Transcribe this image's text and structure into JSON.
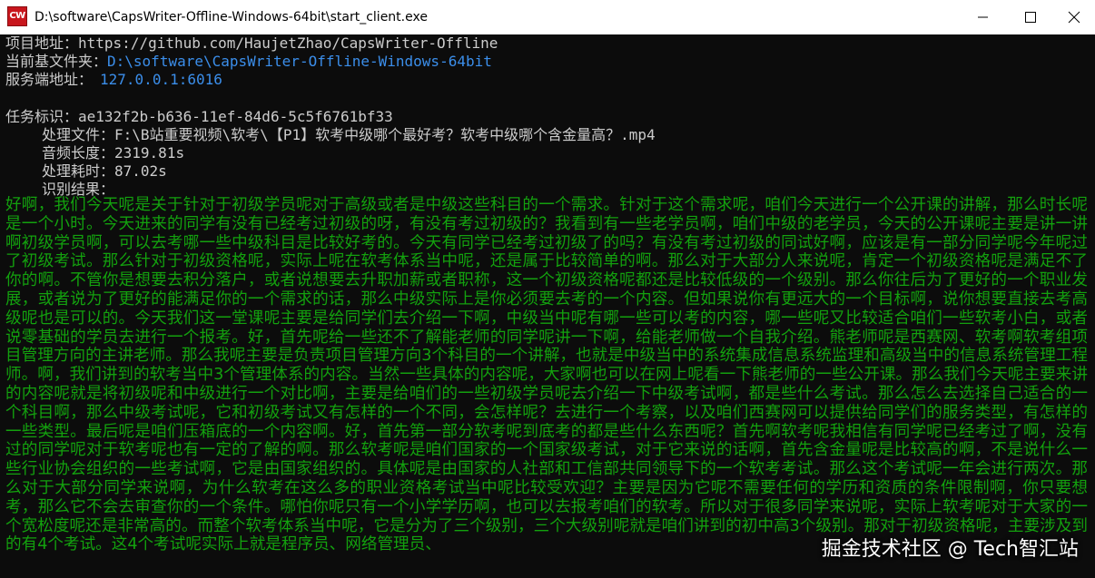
{
  "window": {
    "title": "D:\\software\\CapsWriter-Offline-Windows-64bit\\start_client.exe",
    "icon_label": "CW"
  },
  "header": {
    "project_label": "项目地址：",
    "project_value": "https://github.com/HaujetZhao/CapsWriter-Offline",
    "basedir_label": "当前基文件夹：",
    "basedir_value": "D:\\software\\CapsWriter-Offline-Windows-64bit",
    "server_label": "服务端地址：",
    "server_value": "127.0.0.1:6016"
  },
  "task": {
    "id_label": "任务标识：",
    "id_value": "ae132f2b-b636-11ef-84d6-5c5f6761bf33",
    "file_label": "处理文件：",
    "file_value": "F:\\B站重要视频\\软考\\【P1】软考中级哪个最好考？软考中级哪个含金量高？.mp4",
    "duration_label": "音频长度：",
    "duration_value": "2319.81s",
    "elapsed_label": "处理耗时：",
    "elapsed_value": "87.02s",
    "result_label": "识别结果："
  },
  "result_text": "好啊，我们今天呢是关于针对于初级学员呢对于高级或者是中级这些科目的一个需求。针对于这个需求呢，咱们今天进行一个公开课的讲解，那么时长呢是一个小时。今天进来的同学有没有已经考过初级的呀，有没有考过初级的？我看到有一些老学员啊，咱们中级的老学员，今天的公开课呢主要是讲一讲啊初级学员啊，可以去考哪一些中级科目是比较好考的。今天有同学已经考过初级了的吗？有没有考过初级的同试好啊，应该是有一部分同学呢今年呢过了初级考试。那么针对于初级资格呢，实际上呢在软考体系当中呢，还是属于比较简单的啊。那么对于大部分人来说呢，肯定一个初级资格呢是满足不了你的啊。不管你是想要去积分落户，或者说想要去升职加薪或者职称，这一个初级资格呢都还是比较低级的一个级别。那么你往后为了更好的一个职业发展，或者说为了更好的能满足你的一个需求的话，那么中级实际上是你必须要去考的一个内容。但如果说你有更远大的一个目标啊，说你想要直接去考高级呢也是可以的。今天我们这一堂课呢主要是给同学们去介绍一下啊，中级当中呢有哪一些可以考的内容，哪一些呢又比较适合咱们一些软考小白，或者说零基础的学员去进行一个报考。好，首先呢给一些还不了解能老师的同学呢讲一下啊，给能老师做一个自我介绍。熊老师呢是西赛网、软考啊软考组项目管理方向的主讲老师。那么我呢主要是负责项目管理方向3个科目的一个讲解，也就是中级当中的系统集成信息系统监理和高级当中的信息系统管理工程师。啊，我们讲到的软考当中3个管理体系的内容。当然一些具体的内容呢，大家啊也可以在网上呢看一下熊老师的一些公开课。那么我们今天呢主要来讲的内容呢就是将初级呢和中级进行一个对比啊，主要是给咱们的一些初级学员呢去介绍一下中级考试啊，都是些什么考试。那么怎么去选择自己适合的一个科目啊，那么中级考试呢，它和初级考试又有怎样的一个不同，会怎样呢？去进行一个考察，以及咱们西赛网可以提供给同学们的服务类型，有怎样的一些类型。最后呢是咱们压箱底的一个内容啊。好，首先第一部分软考呢到底考的都是些什么东西呢？首先啊软考呢我相信有同学呢已经考过了啊，没有过的同学呢对于软考呢也有一定的了解的啊。那么软考呢是咱们国家的一个国家级考试，对于它来说的话啊，首先含金量呢是比较高的啊，不是说什么一些行业协会组织的一些考试啊，它是由国家组织的。具体呢是由国家的人社部和工信部共同领导下的一个软考考试。那么这个考试呢一年会进行两次。那么对于大部分同学来说啊，为什么软考在这么多的职业资格考试当中呢比较受欢迎？主要是因为它呢不需要任何的学历和资质的条件限制啊，你只要想考，那么它不会去审查你的一个条件。哪怕你呢只有一个小学学历啊，也可以去报考咱们的软考。所以对于很多同学来说呢，实际上软考呢对于大家的一个宽松度呢还是非常高的。而整个软考体系当中呢，它是分为了三个级别，三个大级别呢就是咱们讲到的初中高3个级别。那对于初级资格呢，主要涉及到的有4个考试。这4个考试呢实际上就是程序员、网络管理员、",
  "watermark": "掘金技术社区 @ Tech智汇站"
}
